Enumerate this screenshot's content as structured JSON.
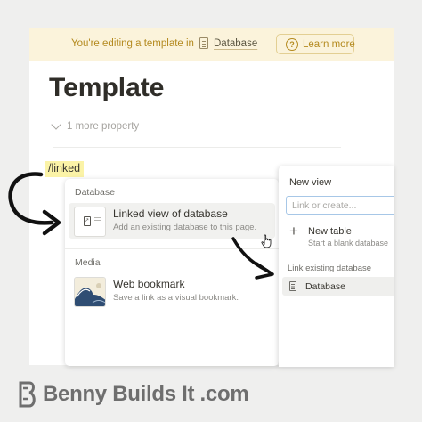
{
  "banner": {
    "text": "You're editing a template in",
    "database_link": "Database",
    "learn_more": "Learn more",
    "learn_icon": "question-circle-icon",
    "doc_icon": "page-icon"
  },
  "page": {
    "title": "Template",
    "more_property": "1 more property",
    "slash_command": "/linked"
  },
  "menu": {
    "section_database": "Database",
    "section_media": "Media",
    "items": [
      {
        "title": "Linked view of database",
        "description": "Add an existing database to this page.",
        "icon": "linked-database-icon"
      },
      {
        "title": "Web bookmark",
        "description": "Save a link as a visual bookmark.",
        "icon": "wave-thumbnail-icon"
      }
    ]
  },
  "panel": {
    "title": "New view",
    "search_placeholder": "Link or create...",
    "new_table_title": "New table",
    "new_table_desc": "Start a blank database",
    "link_existing_label": "Link existing database",
    "database_item": "Database"
  },
  "brand": {
    "text": "Benny Builds It .com"
  },
  "colors": {
    "banner_bg": "#fbf3db",
    "banner_text": "#b48a1f",
    "highlight": "#fbf3a7",
    "focus": "#a7c7e7"
  }
}
